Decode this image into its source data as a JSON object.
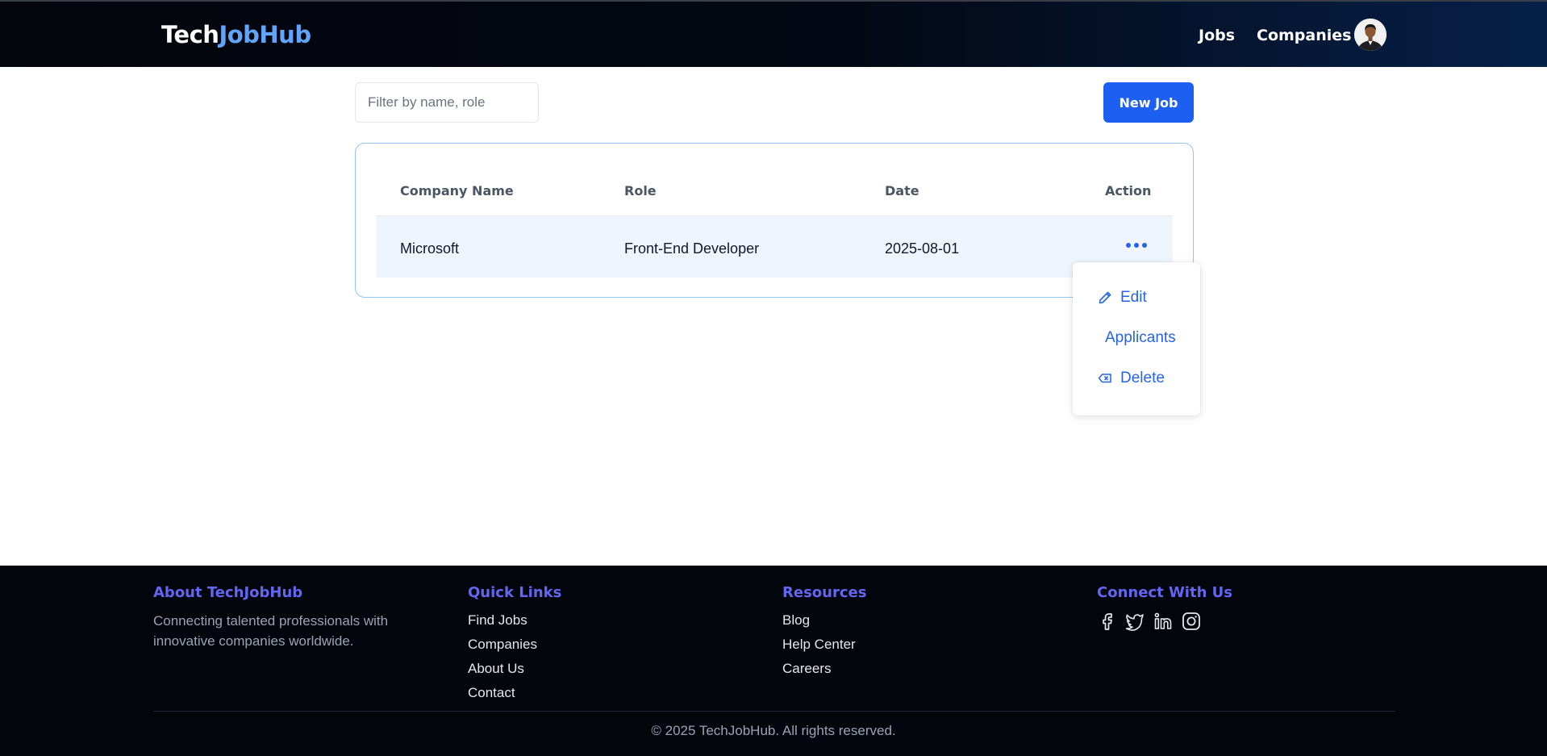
{
  "header": {
    "logo_part1": "Tech",
    "logo_part2": "JobHub",
    "nav": {
      "jobs": "Jobs",
      "companies": "Companies"
    }
  },
  "toolbar": {
    "filter_placeholder": "Filter by name, role",
    "filter_value": "",
    "new_job_label": "New Job"
  },
  "table": {
    "columns": [
      "Company Name",
      "Role",
      "Date",
      "Action"
    ],
    "rows": [
      {
        "company": "Microsoft",
        "role": "Front-End Developer",
        "date": "2025-08-01"
      }
    ]
  },
  "action_menu": {
    "items": [
      {
        "label": "Edit",
        "icon": "pencil-icon"
      },
      {
        "label": "Applicants",
        "icon": ""
      },
      {
        "label": "Delete",
        "icon": "backspace-icon"
      }
    ]
  },
  "footer": {
    "about": {
      "heading": "About TechJobHub",
      "line1": "Connecting talented professionals with",
      "line2": "innovative companies worldwide."
    },
    "quick_links": {
      "heading": "Quick Links",
      "links": [
        "Find Jobs",
        "Companies",
        "About Us",
        "Contact"
      ]
    },
    "resources": {
      "heading": "Resources",
      "links": [
        "Blog",
        "Help Center",
        "Careers"
      ]
    },
    "connect": {
      "heading": "Connect With Us",
      "icons": [
        "facebook-icon",
        "twitter-icon",
        "linkedin-icon",
        "instagram-icon"
      ]
    },
    "copyright": "© 2025 TechJobHub. All rights reserved."
  },
  "colors": {
    "header_bg": "#030814",
    "accent_blue": "#60a5fa",
    "primary_button": "#1d5ff0",
    "row_highlight": "#eef5fe",
    "footer_heading": "#6366f1",
    "footer_bg": "#03050d"
  }
}
